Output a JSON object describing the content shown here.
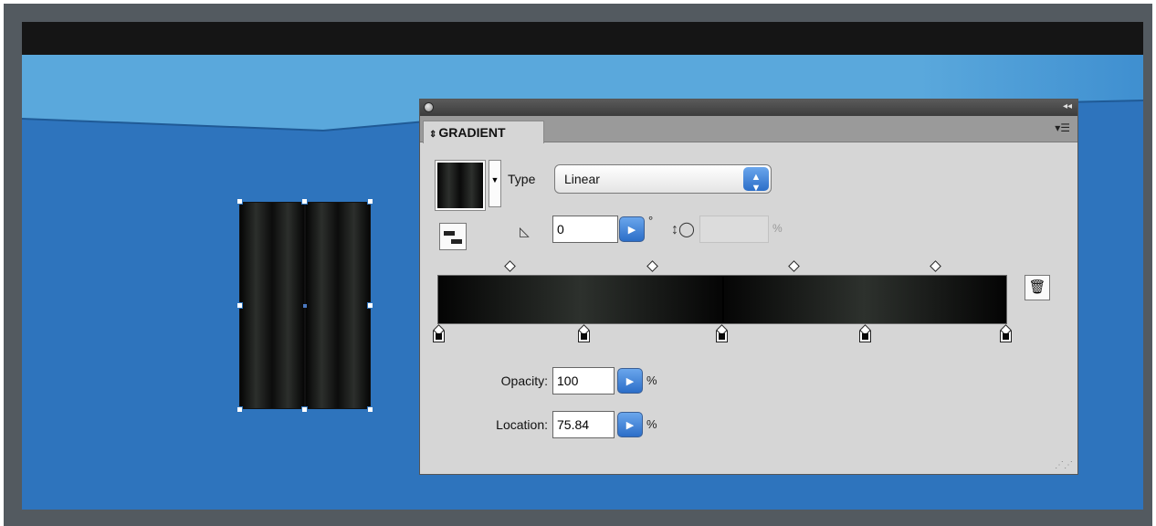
{
  "panel": {
    "tab_label": "GRADIENT",
    "type_label": "Type",
    "type_value": "Linear",
    "angle_value": "0",
    "angle_unit": "°",
    "aspect_unit": "%",
    "opacity_label": "Opacity:",
    "opacity_value": "100",
    "opacity_unit": "%",
    "location_label": "Location:",
    "location_value": "75.84",
    "location_unit": "%",
    "stop_color": "#000000"
  },
  "colors": {
    "canvas_blue": "#2e74bd",
    "sky_blue": "#5aa8dc",
    "frame_gray": "#535a60",
    "accent_blue": "#2c6ec8"
  },
  "icons": [
    "close-icon",
    "collapse-icon",
    "panel-menu-icon",
    "reverse-gradient-icon",
    "angle-icon",
    "aspect-ratio-icon",
    "trash-icon",
    "resize-grip-icon"
  ]
}
